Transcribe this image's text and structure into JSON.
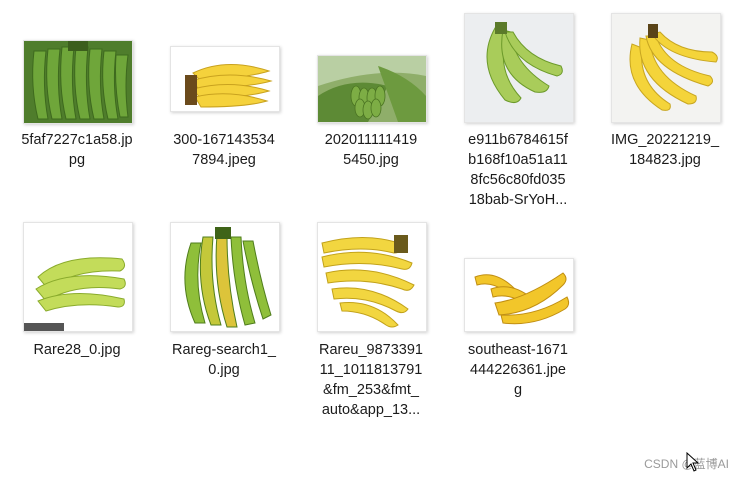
{
  "files": [
    {
      "name": "5faf7227c1a58.jp\npg",
      "icon": "banana-bunch-green-icon"
    },
    {
      "name": "300-167143534\n7894.jpeg",
      "icon": "banana-yellow-icon"
    },
    {
      "name": "202011111419\n5450.jpg",
      "icon": "banana-tree-icon"
    },
    {
      "name": "e911b6784615f\nb168f10a51a11\n8fc56c80fd035\n18bab-SrYoH...",
      "icon": "banana-green-pair-icon"
    },
    {
      "name": "IMG_20221219_\n184823.jpg",
      "icon": "banana-yellow-bunch-icon"
    },
    {
      "name": "Rare28_0.jpg",
      "icon": "banana-lightgreen-icon"
    },
    {
      "name": "Rareg-search1_\n0.jpg",
      "icon": "banana-green-hand-icon"
    },
    {
      "name": "Rareu_9873391\n11_1011813791\n&fm_253&fmt_\nauto&app_13...",
      "icon": "banana-ripe-hand-icon"
    },
    {
      "name": "southeast-1671\n444226361.jpe\ng",
      "icon": "banana-small-yellow-icon"
    }
  ],
  "watermark": "CSDN @蓝博AI"
}
